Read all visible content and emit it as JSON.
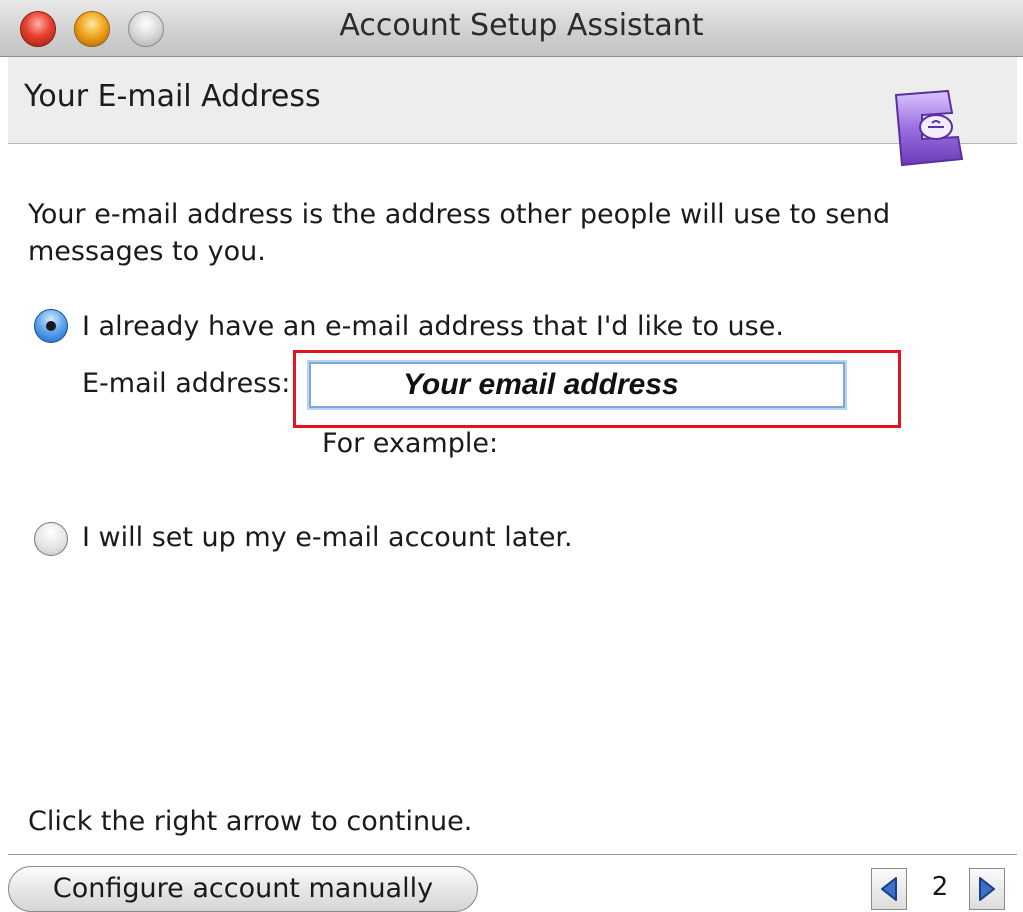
{
  "window": {
    "title": "Account Setup Assistant"
  },
  "header": {
    "title": "Your E-mail Address"
  },
  "main": {
    "description": "Your e-mail address is the address other people will use to send messages to you.",
    "options": [
      {
        "label": "I already have an e-mail address that I'd like to use.",
        "selected": true
      },
      {
        "label": "I will set up my e-mail account later.",
        "selected": false
      }
    ],
    "email_label": "E-mail address:",
    "email_value": "Your email address",
    "example_label": "For example:",
    "instruction": "Click the right arrow to continue."
  },
  "footer": {
    "configure_label": "Configure account manually",
    "page_number": "2"
  },
  "colors": {
    "highlight": "#e0151f",
    "app_icon": "#9b6fe0"
  }
}
